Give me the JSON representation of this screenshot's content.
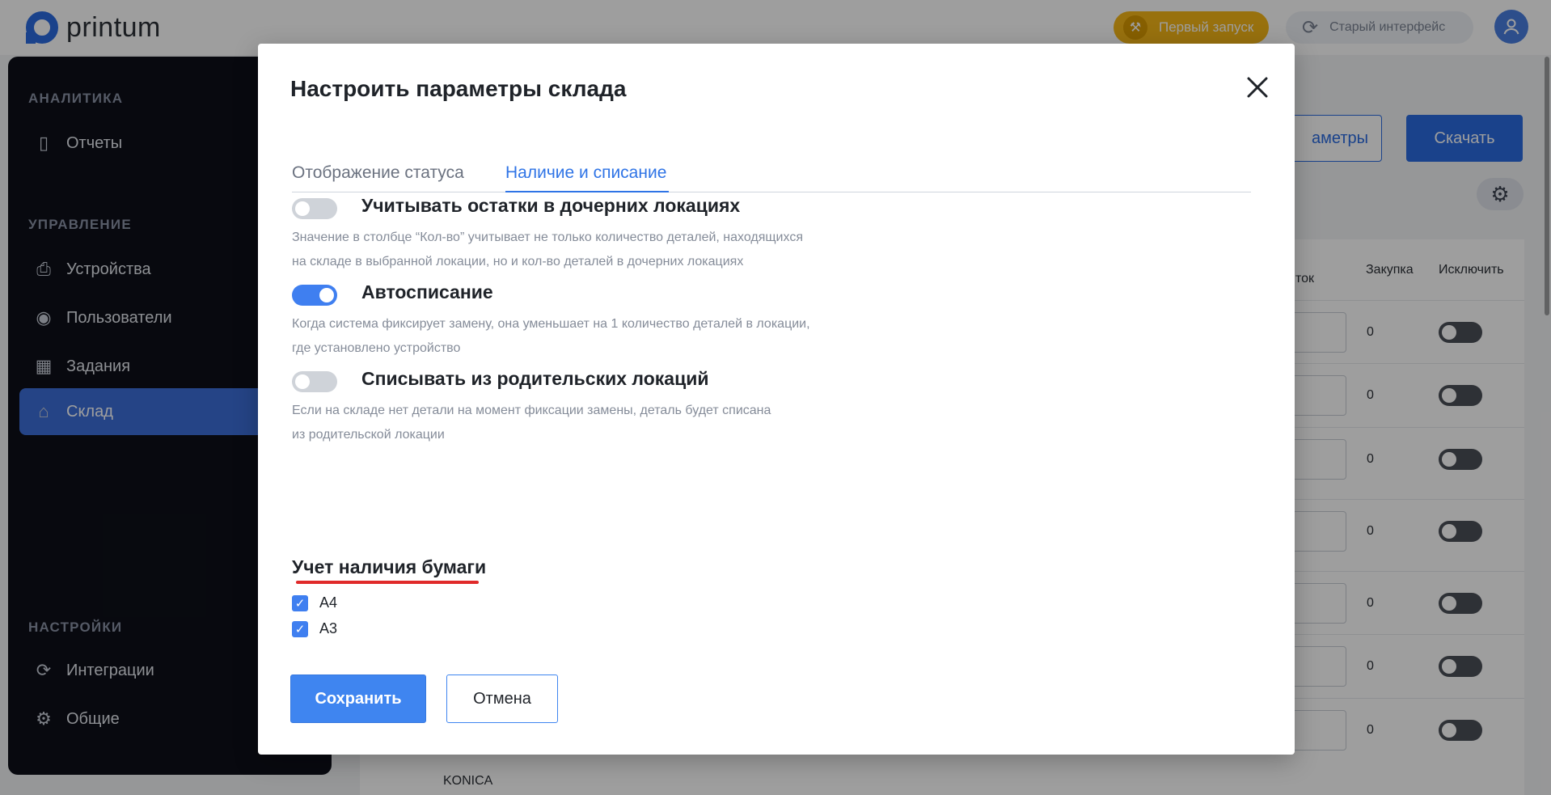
{
  "app": {
    "logo_text": "printum",
    "first_run_label": "Первый запуск",
    "old_ui_label": "Старый интерфейс"
  },
  "sidebar": {
    "sections": [
      {
        "label": "АНАЛИТИКА",
        "items": [
          {
            "label": "Отчеты",
            "icon": "report-icon"
          }
        ]
      },
      {
        "label": "УПРАВЛЕНИЕ",
        "items": [
          {
            "label": "Устройства",
            "icon": "printer-icon"
          },
          {
            "label": "Пользователи",
            "icon": "user-icon"
          },
          {
            "label": "Задания",
            "icon": "calendar-icon"
          },
          {
            "label": "Склад",
            "icon": "warehouse-icon",
            "active": true
          }
        ]
      },
      {
        "label": "НАСТРОЙКИ",
        "items": [
          {
            "label": "Интеграции",
            "icon": "sync-icon"
          },
          {
            "label": "Общие",
            "icon": "gear-icon"
          }
        ]
      }
    ]
  },
  "background": {
    "params_label": "аметры",
    "download_label": "Скачать",
    "columns": {
      "stock": "ток",
      "purchase": "Закупка",
      "exclude": "Исключить"
    },
    "rows": [
      {
        "purchase": "0"
      },
      {
        "purchase": "0"
      },
      {
        "purchase": "0"
      },
      {
        "purchase": "0"
      },
      {
        "purchase": "0"
      },
      {
        "purchase": "0"
      },
      {
        "purchase": "0"
      }
    ],
    "bottom_text": "KONICA"
  },
  "modal": {
    "title": "Настроить параметры склада",
    "tabs": [
      {
        "label": "Отображение статуса",
        "active": false
      },
      {
        "label": "Наличие и списание",
        "active": true
      }
    ],
    "settings": [
      {
        "title": "Учитывать остатки в дочерних локациях",
        "desc_line1": "Значение в столбце “Кол-во” учитывает не только количество деталей, находящихся",
        "desc_line2": "на складе в выбранной локации, но и кол-во деталей в дочерних локациях",
        "enabled": false
      },
      {
        "title": "Автосписание",
        "desc_line1": "Когда система фиксирует замену, она уменьшает на 1 количество деталей в локации,",
        "desc_line2": "где установлено устройство",
        "enabled": true
      },
      {
        "title": "Списывать из родительских локаций",
        "desc_line1": "Если на складе нет детали на момент фиксации замены, деталь будет списана",
        "desc_line2": "из родительской локации",
        "enabled": false
      }
    ],
    "paper_title": "Учет наличия бумаги",
    "paper_options": [
      {
        "label": "A4",
        "checked": true
      },
      {
        "label": "A3",
        "checked": true
      }
    ],
    "save_label": "Сохранить",
    "cancel_label": "Отмена"
  },
  "colors": {
    "accent": "#3f7ff0",
    "sidebar_bg": "#0d1019",
    "first_run_bg": "#f5b718",
    "highlight_underline": "#e02a2a"
  }
}
